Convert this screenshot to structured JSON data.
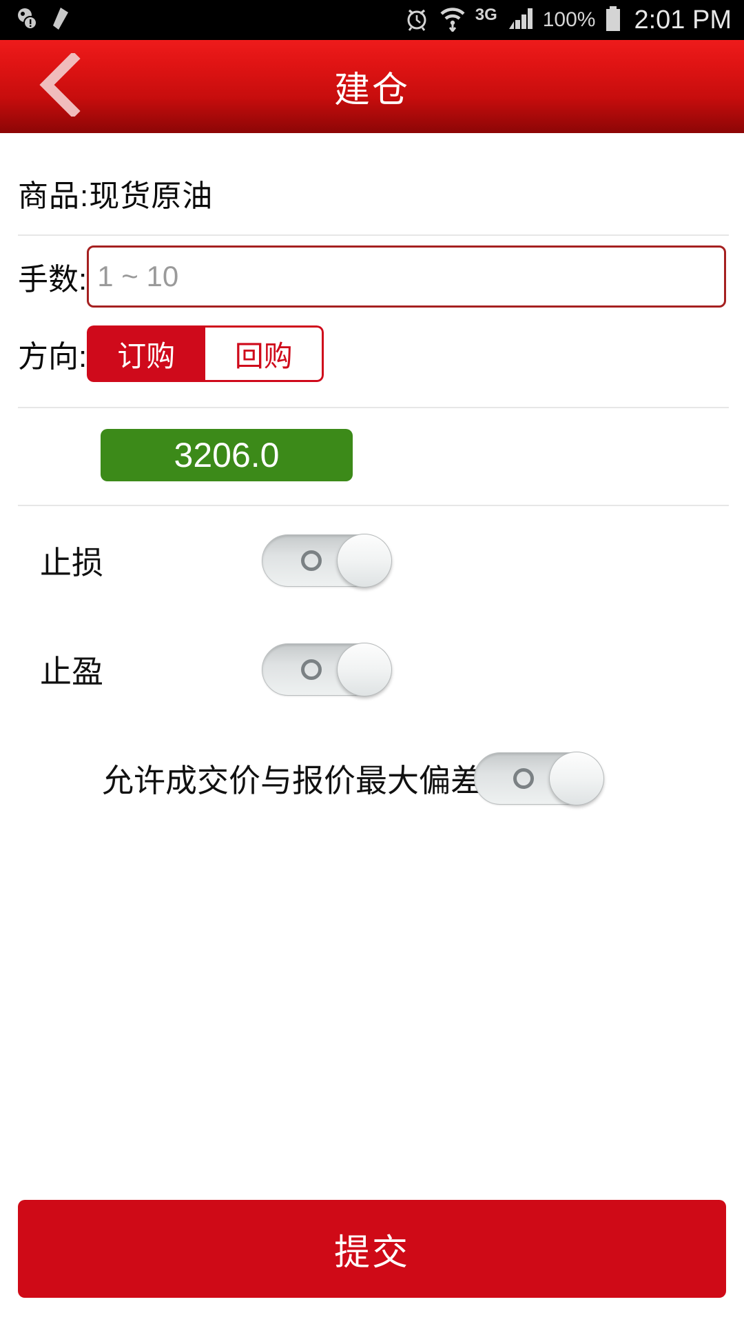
{
  "status_bar": {
    "left_icons": [
      "notification-warning-icon",
      "edit-pencil-icon"
    ],
    "right_icons": [
      "alarm-clock-icon",
      "wifi-icon",
      "signal-bars-icon",
      "battery-icon"
    ],
    "network_label": "3G",
    "battery_label": "100%",
    "time": "2:01 PM"
  },
  "header": {
    "title": "建仓",
    "back_icon": "chevron-left-icon",
    "bg_color": "#cf0d0d"
  },
  "form": {
    "product_line": "商品:现货原油",
    "lots": {
      "label": "手数:",
      "value": "",
      "placeholder": "1 ~ 10"
    },
    "direction": {
      "label": "方向:",
      "options": [
        {
          "label": "订购",
          "selected": true
        },
        {
          "label": "回购",
          "selected": false
        }
      ],
      "accent_color": "#cf0a1b"
    },
    "price": {
      "value": "3206.0",
      "color": "#3c8a19"
    },
    "toggles": [
      {
        "label": "止损",
        "state": "off"
      },
      {
        "label": "止盈",
        "state": "off"
      },
      {
        "label": "允许成交价与报价最大偏差",
        "state": "off"
      }
    ]
  },
  "submit": {
    "label": "提交",
    "color": "#cf0a17"
  }
}
